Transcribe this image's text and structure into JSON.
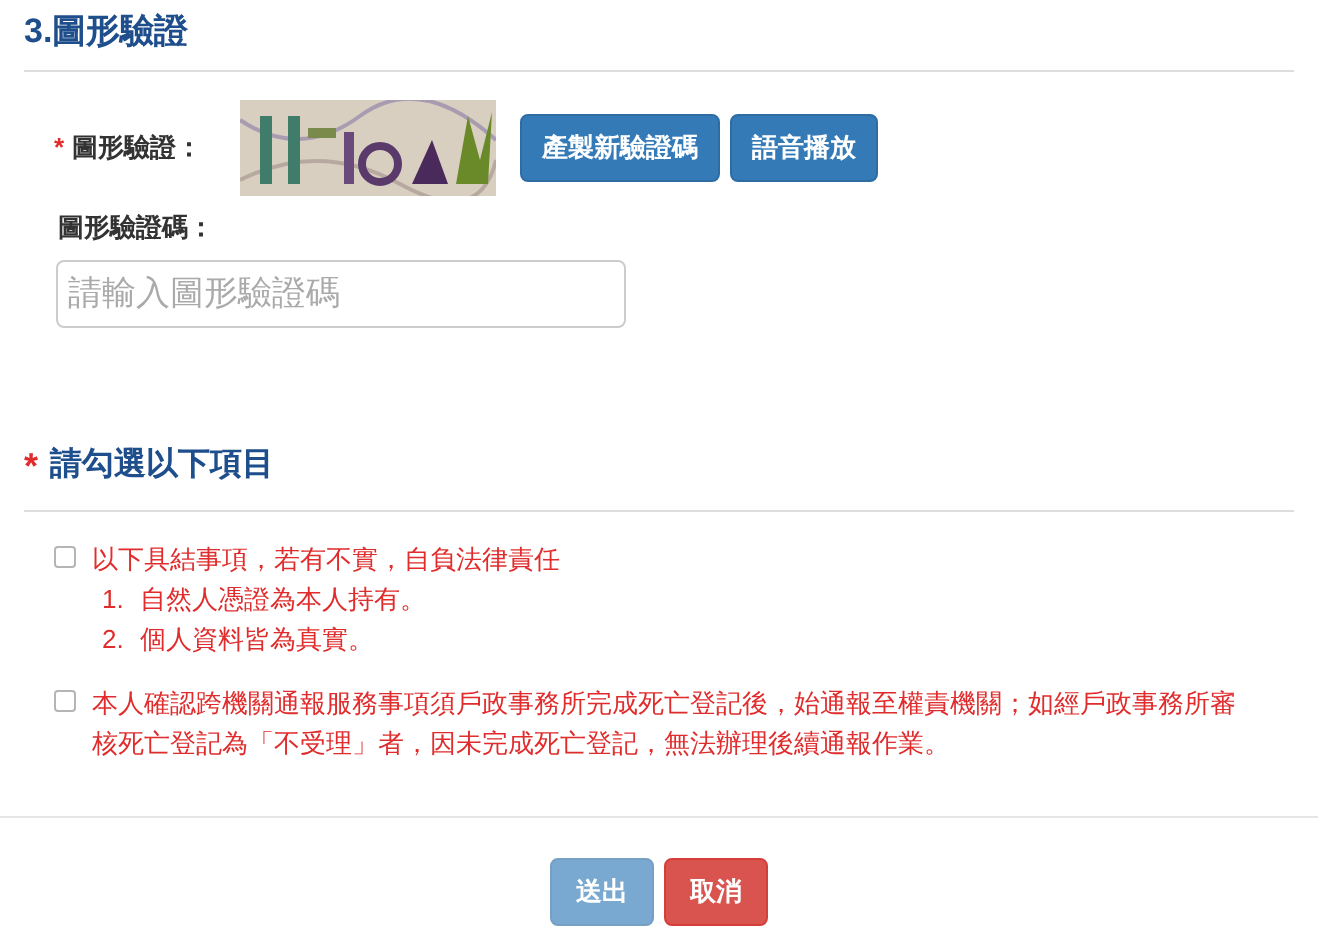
{
  "section_title": "3.圖形驗證",
  "captcha": {
    "required_mark": "*",
    "label": "圖形驗證：",
    "buttons": [
      "產製新驗證碼",
      "語音播放"
    ]
  },
  "code_field": {
    "label": "圖形驗證碼：",
    "placeholder": "請輸入圖形驗證碼"
  },
  "checklist": {
    "required_mark": "*",
    "title": "請勾選以下項目",
    "items": [
      {
        "text": "以下具結事項，若有不實，自負法律責任",
        "checked": false,
        "sub_items": [
          {
            "number": "1.",
            "text": "自然人憑證為本人持有。"
          },
          {
            "number": "2.",
            "text": "個人資料皆為真實。"
          }
        ]
      },
      {
        "text": "本人確認跨機關通報服務事項須戶政事務所完成死亡登記後，始通報至權責機關；如經戶政事務所審核死亡登記為「不受理」者，因未完成死亡登記，無法辦理後續通報作業。",
        "checked": false
      }
    ]
  },
  "actions": [
    {
      "label": "送出",
      "kind": "submit",
      "disabled": true
    },
    {
      "label": "取消",
      "kind": "cancel",
      "disabled": false
    }
  ]
}
